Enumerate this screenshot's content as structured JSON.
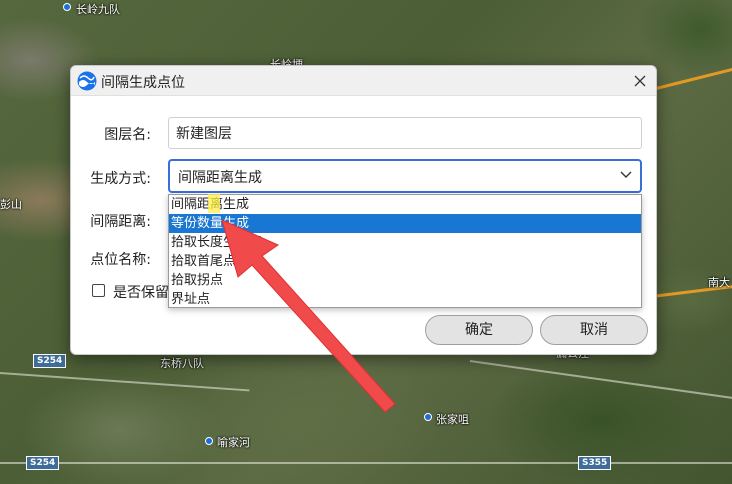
{
  "map": {
    "labels": {
      "l1": "长岭九队",
      "l2": "长岭埂",
      "l3": "彭山",
      "l4": "南大",
      "l5": "东桥八队",
      "l6": "喻家河",
      "l7": "张家咀",
      "l8": "漏公洼"
    },
    "road_signs": {
      "s1": "S254",
      "s2": "S254",
      "s3": "S355"
    },
    "road_color": "#e39a24"
  },
  "dialog": {
    "title": "间隔生成点位",
    "app_icon": "app-logo-icon",
    "close_icon": "close-icon",
    "fields": {
      "layer_name_label": "图层名:",
      "layer_name_value": "新建图层",
      "method_label": "生成方式:",
      "method_value": "间隔距离生成",
      "distance_label": "间隔距离:",
      "point_name_label": "点位名称:",
      "keep_label": "是否保留"
    },
    "dropdown": {
      "options": [
        "间隔距离生成",
        "等份数量生成",
        "拾取长度生成点",
        "拾取首尾点",
        "拾取拐点",
        "界址点"
      ],
      "highlighted_index": 1
    },
    "buttons": {
      "ok": "确定",
      "cancel": "取消"
    },
    "accent_color": "#1976d2",
    "annotation_color": "#f04a4a"
  }
}
